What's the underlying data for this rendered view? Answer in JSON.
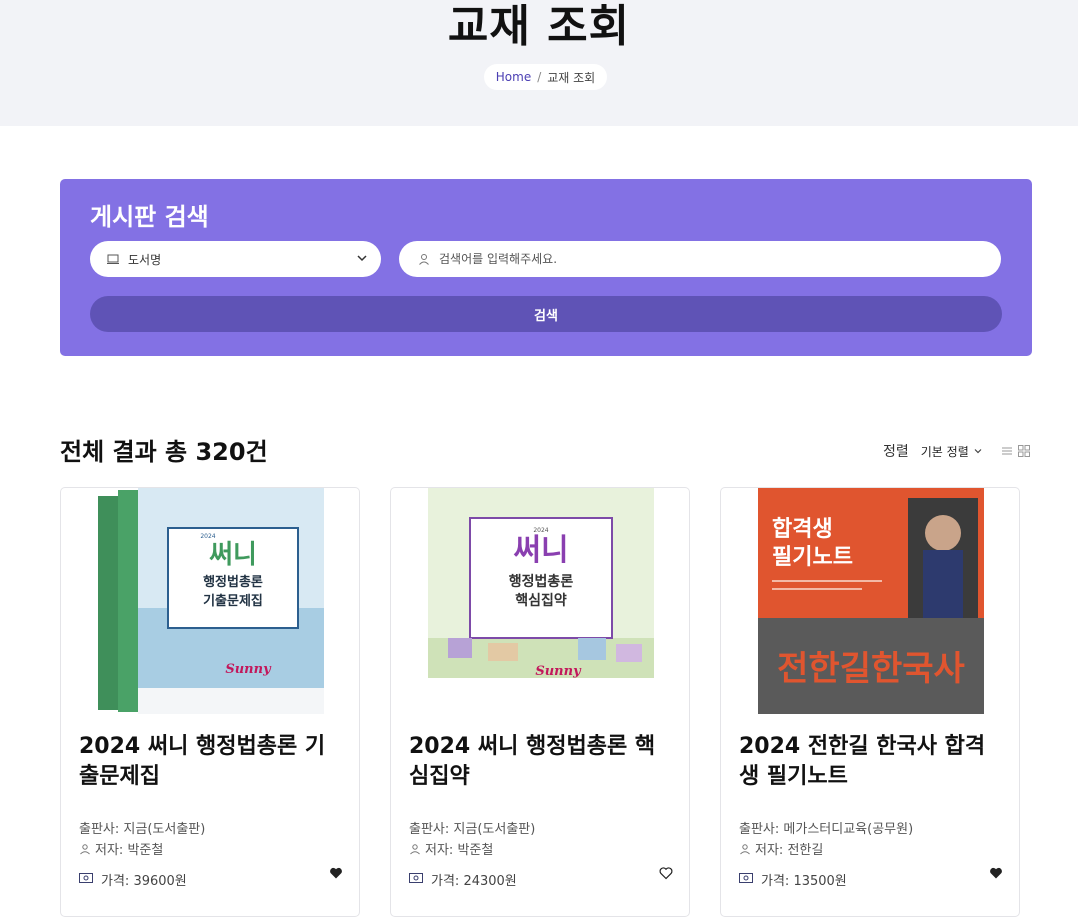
{
  "page": {
    "title": "교재 조회",
    "breadcrumb": {
      "home": "Home",
      "separator": "/",
      "current": "교재 조회"
    }
  },
  "search": {
    "title": "게시판 검색",
    "select_value": "도서명",
    "input_placeholder": "검색어를 입력해주세요.",
    "button_label": "검색"
  },
  "results": {
    "title": "전체 결과 총 320건",
    "sort_label": "정렬",
    "sort_value": "기본 정렬"
  },
  "books": [
    {
      "title": "2024 써니 행정법총론 기출문제집",
      "publisher_label": "출판사:",
      "publisher": "지금(도서출판)",
      "author_label": "저자:",
      "author": "박준철",
      "price_label": "가격:",
      "price": "39600원",
      "liked": true,
      "cover": {
        "brand": "써니",
        "line1": "행정법총론",
        "line2": "기출문제집",
        "series": "Sunny",
        "year": "2024",
        "colors": [
          "#cfe3ef",
          "#3f8f5a"
        ]
      }
    },
    {
      "title": "2024 써니 행정법총론 핵심집약",
      "publisher_label": "출판사:",
      "publisher": "지금(도서출판)",
      "author_label": "저자:",
      "author": "박준철",
      "price_label": "가격:",
      "price": "24300원",
      "liked": false,
      "cover": {
        "brand": "써니",
        "line1": "행정법총론",
        "line2": "핵심집약",
        "series": "Sunny",
        "year": "2024",
        "colors": [
          "#e6f0d6",
          "#8a3fb0"
        ]
      }
    },
    {
      "title": "2024 전한길 한국사 합격생 필기노트",
      "publisher_label": "출판사:",
      "publisher": "메가스터디교육(공무원)",
      "author_label": "저자:",
      "author": "전한길",
      "price_label": "가격:",
      "price": "13500원",
      "liked": true,
      "cover": {
        "line1": "합격생",
        "line2": "필기노트",
        "big": "전한길한국사",
        "colors": [
          "#e0552f",
          "#5a5a5a"
        ]
      }
    }
  ],
  "icons": {
    "select": "book-icon",
    "input": "user-icon",
    "author": "user-icon",
    "price": "money-icon",
    "like": "heart-icon",
    "view_list": "list-view-icon",
    "view_grid": "grid-view-icon"
  }
}
